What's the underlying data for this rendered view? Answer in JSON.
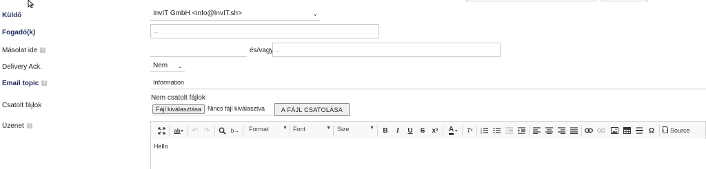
{
  "labels": {
    "sender": "Küldő",
    "recipient": "Fogadó(k)",
    "cc": "Másolat ide",
    "delivery_ack": "Delivery Ack.",
    "email_topic": "Email topic",
    "attachments": "Csatolt fájlok",
    "message": "Üzenet"
  },
  "help_glyph": "?",
  "sender_select": {
    "value": "InvIT GmbH <info@InvIT.sh>"
  },
  "recipient_input": {
    "value": "",
    "placeholder": "_"
  },
  "cc": {
    "value": "",
    "connector": "és/vagy",
    "alt_placeholder": "_"
  },
  "delivery_ack_select": {
    "value": "Nem"
  },
  "email_topic_value": "Information",
  "attachments": {
    "not_attached_label": "Nem csatolt fájlok",
    "choose_button": "Fájl kiválasztása",
    "no_file_text": "Nincs fájl kiválasztva",
    "attach_button": "A FÁJL CSATOLÁSA"
  },
  "toolbar": {
    "format_label": "Format",
    "font_label": "Font",
    "size_label": "Size",
    "source_label": "Source",
    "icons": [
      "maximize-icon",
      "spellcheck-icon",
      "undo-icon",
      "redo-icon",
      "find-icon",
      "replace-icon",
      "bold-icon",
      "italic-icon",
      "underline-icon",
      "strikethrough-icon",
      "superscript-icon",
      "text-color-icon",
      "remove-format-icon",
      "numbered-list-icon",
      "bulleted-list-icon",
      "outdent-icon",
      "indent-icon",
      "align-left-icon",
      "align-center-icon",
      "align-right-icon",
      "justify-icon",
      "link-icon",
      "unlink-icon",
      "image-icon",
      "table-icon",
      "horizontal-rule-icon",
      "special-char-icon",
      "source-icon"
    ]
  },
  "editor_body": "Hello"
}
